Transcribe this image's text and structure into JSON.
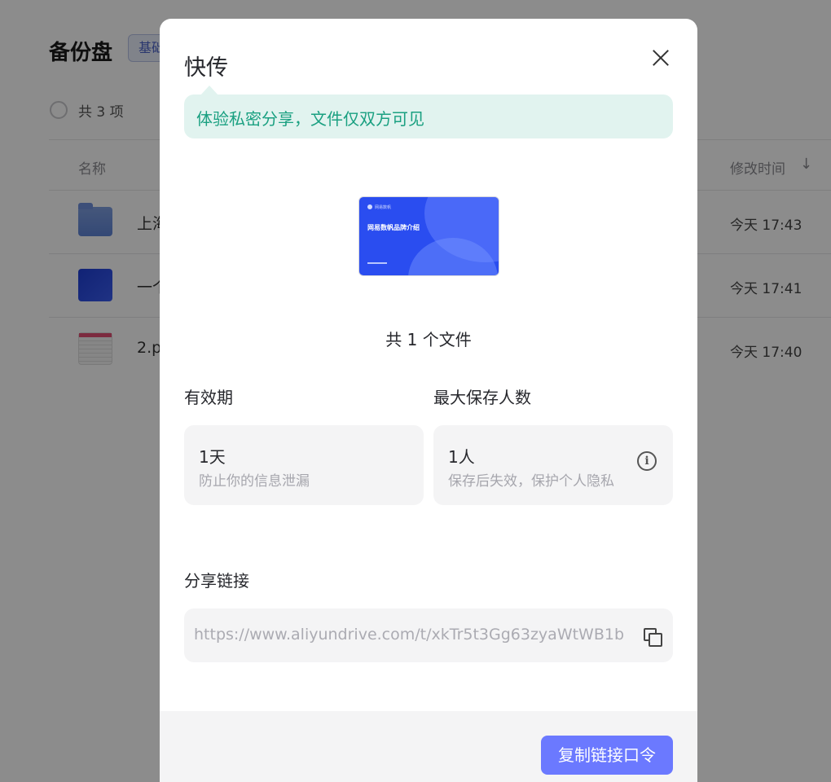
{
  "background": {
    "title": "备份盘",
    "badge": "基础",
    "count_text": "共 3 项",
    "column_name": "名称",
    "column_time": "修改时间",
    "sort_icon": "↓",
    "rows": [
      {
        "name": "上海",
        "time": "今天 17:43",
        "type": "folder"
      },
      {
        "name": "一个",
        "time": "今天 17:41",
        "type": "ppt"
      },
      {
        "name": "2.p",
        "time": "今天 17:40",
        "type": "sheet"
      }
    ]
  },
  "modal": {
    "title": "快传",
    "tip": "体验私密分享，文件仅双方可见",
    "preview": {
      "logo_text": "网易数帆",
      "title": "网易数帆品牌介绍"
    },
    "file_count": "共 1 个文件",
    "validity": {
      "label": "有效期",
      "value": "1天",
      "desc": "防止你的信息泄漏"
    },
    "max_savers": {
      "label": "最大保存人数",
      "value": "1人",
      "desc": "保存后失效，保护个人隐私",
      "info_glyph": "i"
    },
    "share_link": {
      "label": "分享链接",
      "url": "https://www.aliyundrive.com/t/xkTr5t3Gg63zyaWtWB1b"
    },
    "primary_button": "复制链接口令"
  },
  "colors": {
    "accent": "#6b79ff",
    "tip_bg": "#e1f3ef",
    "tip_text": "#1aa081",
    "overlay": "rgba(0,0,0,0.45)"
  }
}
